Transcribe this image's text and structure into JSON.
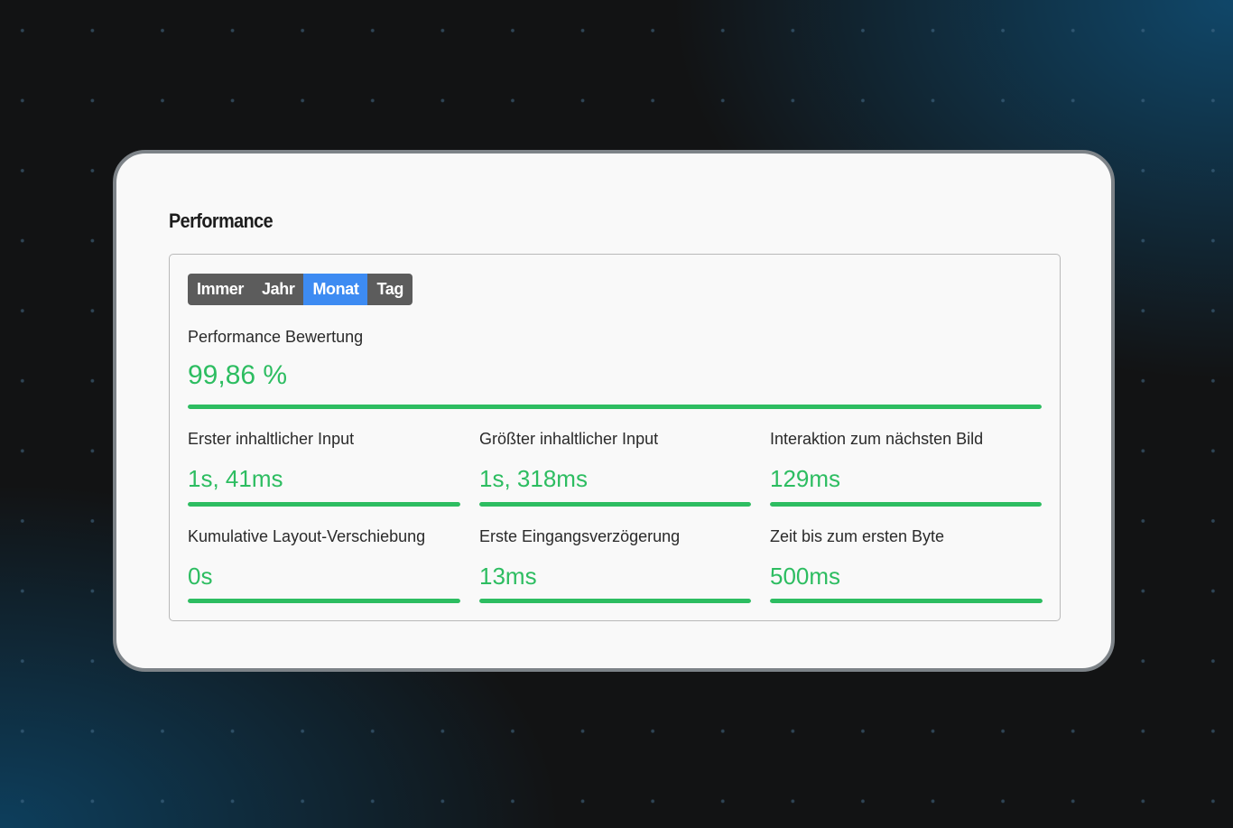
{
  "card": {
    "title": "Performance"
  },
  "tabs": [
    {
      "label": "Immer",
      "active": false
    },
    {
      "label": "Jahr",
      "active": false
    },
    {
      "label": "Monat",
      "active": true
    },
    {
      "label": "Tag",
      "active": false
    }
  ],
  "score": {
    "label": "Performance Bewertung",
    "value": "99,86 %",
    "fill_fraction": 1.0
  },
  "metrics": [
    {
      "label": "Erster inhaltlicher Input",
      "value": "1s, 41ms",
      "fill_fraction": 1.0
    },
    {
      "label": "Größter inhaltlicher Input",
      "value": "1s, 318ms",
      "fill_fraction": 1.0
    },
    {
      "label": "Interaktion zum nächsten Bild",
      "value": "129ms",
      "fill_fraction": 1.0
    },
    {
      "label": "Kumulative Layout-Verschiebung",
      "value": "0s",
      "fill_fraction": 1.0
    },
    {
      "label": "Erste Eingangsverzögerung",
      "value": "13ms",
      "fill_fraction": 1.0
    },
    {
      "label": "Zeit bis zum ersten Byte",
      "value": "500ms",
      "fill_fraction": 1.0
    }
  ],
  "colors": {
    "accent_green": "#2dbd61",
    "tab_active": "#3d8bf2",
    "tab_background": "#5c5c5c",
    "card_background": "#f9f9f9",
    "page_background": "#121314"
  }
}
